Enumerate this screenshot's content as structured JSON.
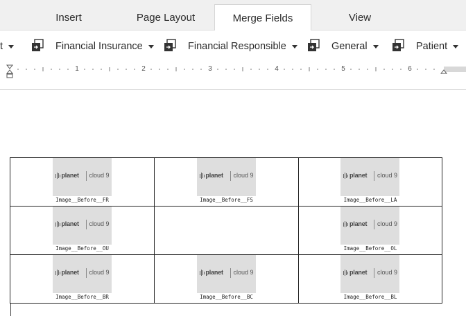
{
  "tabs": [
    {
      "label": "Insert",
      "active": false
    },
    {
      "label": "Page Layout",
      "active": false
    },
    {
      "label": "Merge Fields",
      "active": true
    },
    {
      "label": "View",
      "active": false
    }
  ],
  "toolbar": {
    "partial_left_label": "t",
    "items": [
      {
        "label": "Financial Insurance",
        "icon": "merge-field-icon"
      },
      {
        "label": "Financial Responsible",
        "icon": "merge-field-icon"
      },
      {
        "label": "General",
        "icon": "merge-field-icon"
      },
      {
        "label": "Patient",
        "icon": "merge-field-icon"
      }
    ]
  },
  "ruler": {
    "numbers": [
      "1",
      "2",
      "3",
      "4",
      "5",
      "6"
    ]
  },
  "logo": {
    "brand": "planet",
    "product": "cloud 9"
  },
  "table": {
    "rows": [
      [
        {
          "has_image": true,
          "field": "Image__Before__FR"
        },
        {
          "has_image": true,
          "field": "Image__Before__FS"
        },
        {
          "has_image": true,
          "field": "Image__Before__LA"
        }
      ],
      [
        {
          "has_image": true,
          "field": "Image__Before__OU"
        },
        {
          "has_image": false,
          "field": ""
        },
        {
          "has_image": true,
          "field": "Image__Before__OL"
        }
      ],
      [
        {
          "has_image": true,
          "field": "Image__Before__BR"
        },
        {
          "has_image": true,
          "field": "Image__Before__BC"
        },
        {
          "has_image": true,
          "field": "Image__Before__BL"
        }
      ]
    ]
  },
  "colors": {
    "tabbar_bg": "#f0f0f0",
    "logo_bg": "#dedede",
    "border": "#222222"
  }
}
